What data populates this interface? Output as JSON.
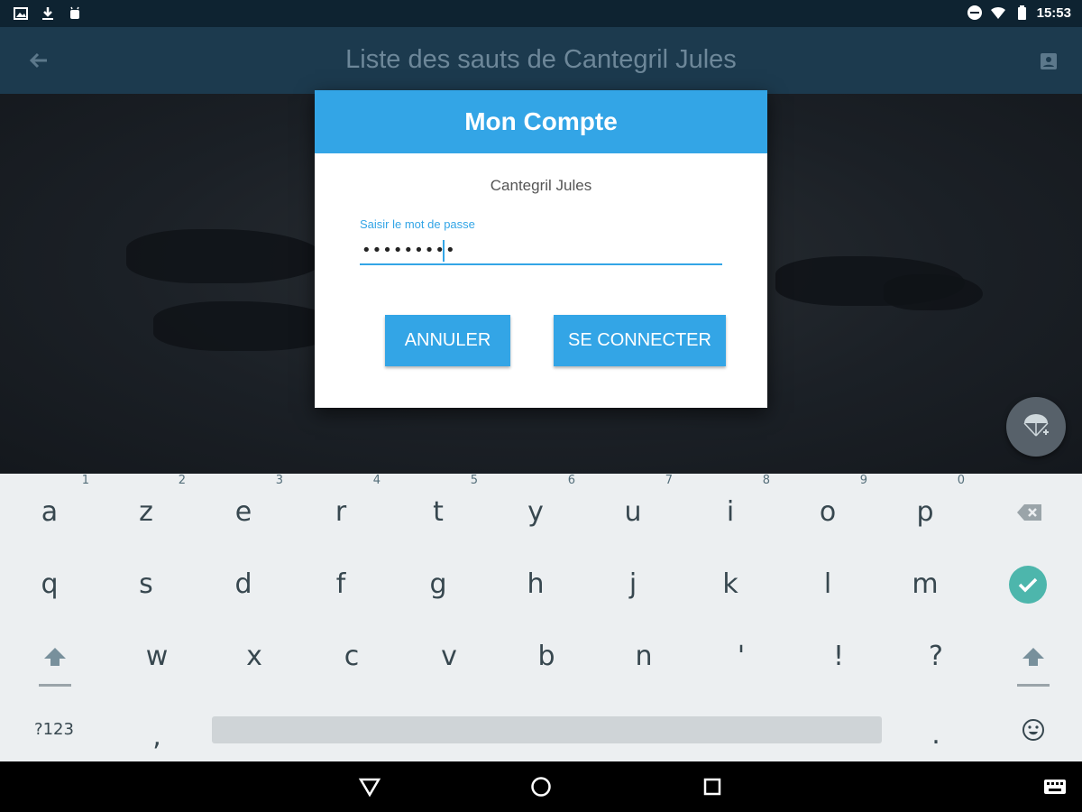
{
  "status_bar": {
    "time": "15:53"
  },
  "app_bar": {
    "title": "Liste des sauts de Cantegril Jules"
  },
  "dialog": {
    "title": "Mon Compte",
    "user_name": "Cantegril Jules",
    "password_label": "Saisir le mot de passe",
    "password_value": "•••••••••",
    "cancel_label": "ANNULER",
    "connect_label": "SE CONNECTER"
  },
  "keyboard": {
    "row1": [
      "a",
      "z",
      "e",
      "r",
      "t",
      "y",
      "u",
      "i",
      "o",
      "p"
    ],
    "row1_hints": [
      "1",
      "2",
      "3",
      "4",
      "5",
      "6",
      "7",
      "8",
      "9",
      "0"
    ],
    "row2": [
      "q",
      "s",
      "d",
      "f",
      "g",
      "h",
      "j",
      "k",
      "l",
      "m"
    ],
    "row3": [
      "w",
      "x",
      "c",
      "v",
      "b",
      "n",
      "'",
      "!",
      "?"
    ],
    "symbols_label": "?123",
    "comma": ",",
    "period": "."
  },
  "colors": {
    "accent": "#33a5e6",
    "enter": "#4db6ac"
  }
}
